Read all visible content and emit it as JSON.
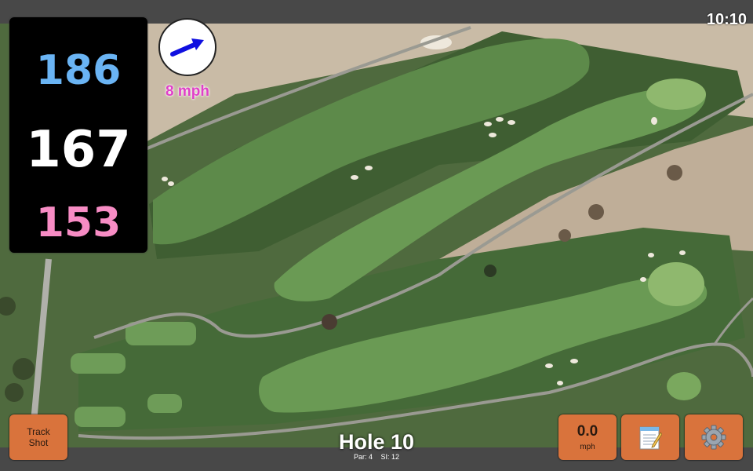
{
  "status": {
    "time": "10:10"
  },
  "distances": {
    "back": "186",
    "middle": "167",
    "front": "153"
  },
  "wind": {
    "speed": "8 mph",
    "arrow_color": "#1010e0"
  },
  "hole": {
    "title": "Hole 10",
    "par": "Par: 4",
    "stroke_index": "SI: 12"
  },
  "buttons": {
    "track_shot_line1": "Track",
    "track_shot_line2": "Shot",
    "speed_value": "0.0",
    "speed_unit": "mph",
    "notes_icon": "notepad-icon",
    "settings_icon": "gear-icon"
  },
  "colors": {
    "button": "#d9733c",
    "back": "#6ab4f4",
    "middle": "#ffffff",
    "front": "#f78cc4",
    "wind_text": "#e040c8"
  }
}
